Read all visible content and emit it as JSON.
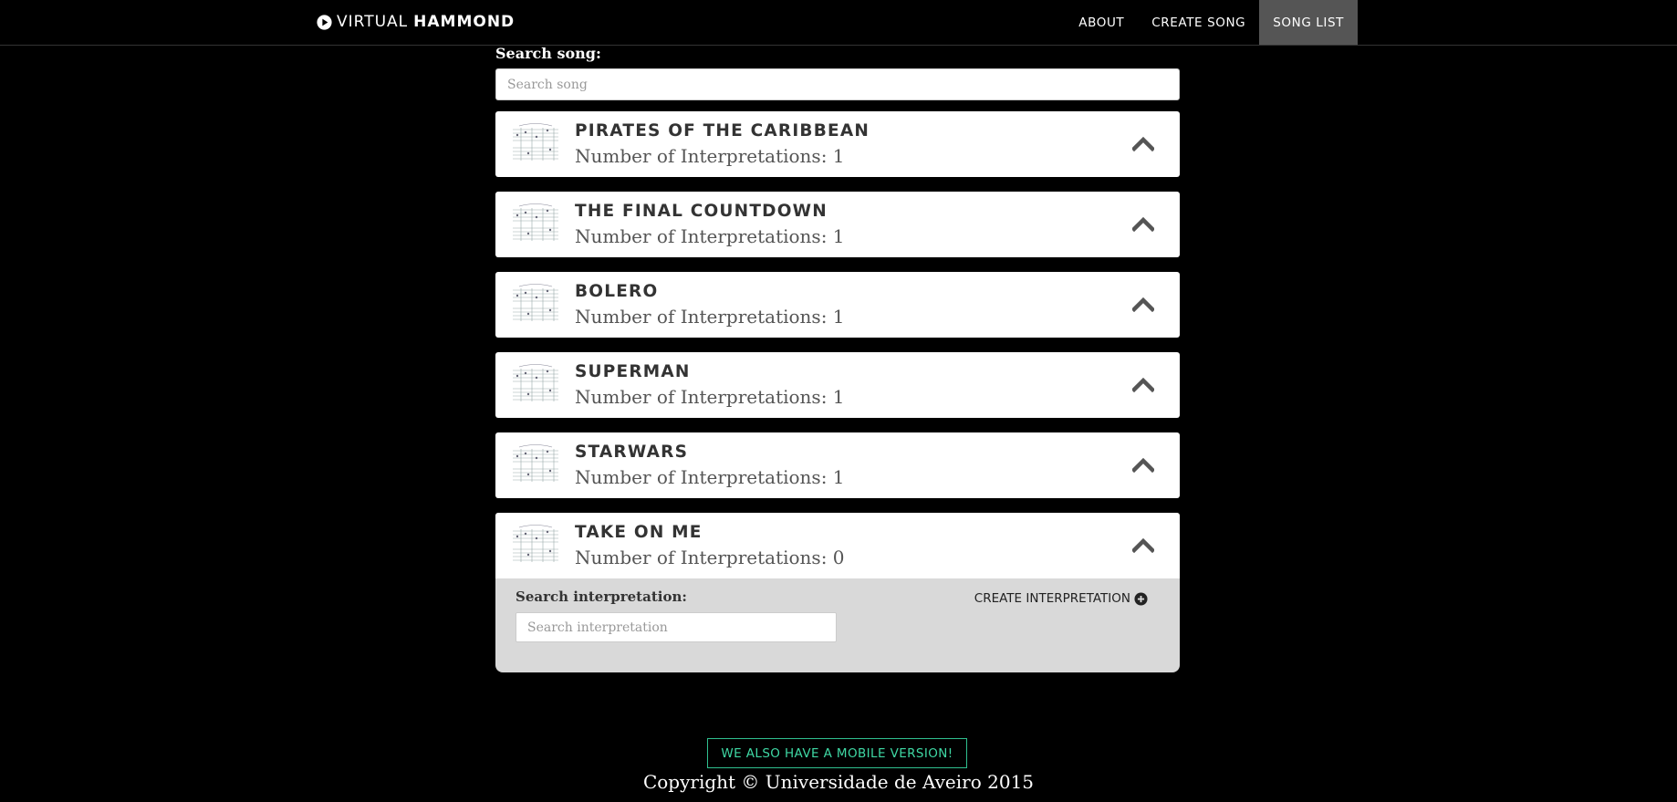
{
  "navbar": {
    "brand_light": "VIRTUAL",
    "brand_bold": "HAMMOND",
    "items": [
      {
        "label": "ABOUT"
      },
      {
        "label": "CREATE SONG"
      },
      {
        "label": "SONG LIST"
      }
    ],
    "active": "SONG LIST"
  },
  "search": {
    "label": "Search song:",
    "placeholder": "Search song"
  },
  "songs": [
    {
      "title": "PIRATES OF THE CARIBBEAN",
      "interpretations": "Number of Interpretations: 1"
    },
    {
      "title": "THE FINAL COUNTDOWN",
      "interpretations": "Number of Interpretations: 1"
    },
    {
      "title": "BOLERO",
      "interpretations": "Number of Interpretations: 1"
    },
    {
      "title": "SUPERMAN",
      "interpretations": "Number of Interpretations: 1"
    },
    {
      "title": "STARWARS",
      "interpretations": "Number of Interpretations: 1"
    },
    {
      "title": "TAKE ON ME",
      "interpretations": "Number of Interpretations: 0"
    }
  ],
  "interpretation_panel": {
    "label": "Search interpretation:",
    "placeholder": "Search interpretation",
    "create_label": "CREATE INTERPRETATION"
  },
  "footer": {
    "mobile_label": "WE ALSO HAVE A MOBILE VERSION!",
    "copyright": "Copyright © Universidade de Aveiro 2015"
  },
  "colors": {
    "background": "#000000",
    "card": "#ffffff",
    "panel": "#d9d9d9",
    "nav_active": "#555555",
    "mobile_accent": "#3fd8a4"
  }
}
